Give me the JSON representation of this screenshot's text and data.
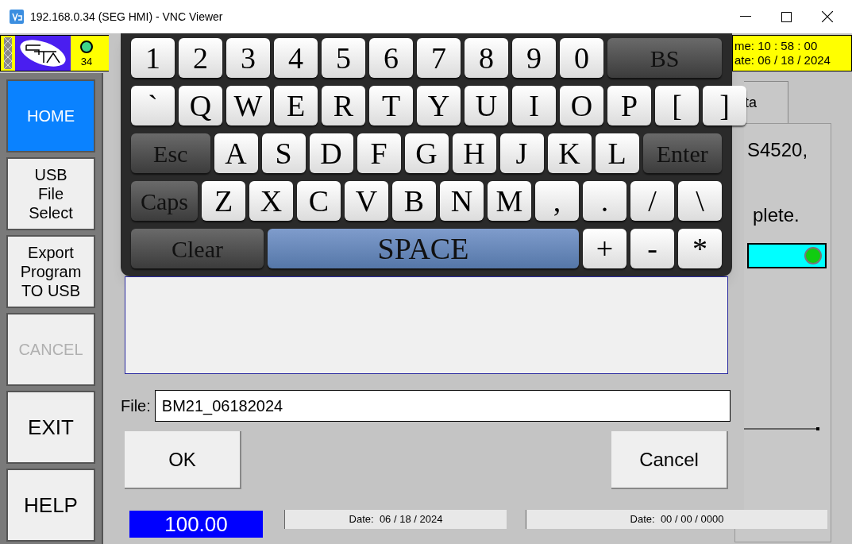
{
  "window": {
    "title": "192.168.0.34 (SEG HMI) - VNC Viewer"
  },
  "header": {
    "counter": "34",
    "status_on": true,
    "time": "me: 10 : 58 : 00",
    "date": "ate: 06 / 18 / 2024"
  },
  "sidebar": {
    "items": [
      {
        "label": "HOME",
        "selected": true,
        "disabled": false,
        "large": false
      },
      {
        "label": "USB\nFile\nSelect",
        "selected": false,
        "disabled": false,
        "large": false
      },
      {
        "label": "Export\nProgram\nTO USB",
        "selected": false,
        "disabled": false,
        "large": false
      },
      {
        "label": "CANCEL",
        "selected": false,
        "disabled": true,
        "large": false
      },
      {
        "label": "EXIT",
        "selected": false,
        "disabled": false,
        "large": true
      },
      {
        "label": "HELP",
        "selected": false,
        "disabled": false,
        "large": true
      }
    ]
  },
  "background_panel": {
    "tab": "ta",
    "line_1": "S4520,",
    "line_2": "plete.",
    "indicator_on": true
  },
  "bottom_panels": {
    "value": "100.00",
    "date_1": "Date:  06 / 18 / 2024",
    "date_2": "Date:  00 / 00 / 0000"
  },
  "keyboard": {
    "rows": [
      {
        "keys": [
          {
            "label": "1",
            "kind": "char"
          },
          {
            "label": "2",
            "kind": "char"
          },
          {
            "label": "3",
            "kind": "char"
          },
          {
            "label": "4",
            "kind": "char"
          },
          {
            "label": "5",
            "kind": "char"
          },
          {
            "label": "6",
            "kind": "char"
          },
          {
            "label": "7",
            "kind": "char"
          },
          {
            "label": "8",
            "kind": "char"
          },
          {
            "label": "9",
            "kind": "char"
          },
          {
            "label": "0",
            "kind": "char"
          },
          {
            "label": "BS",
            "kind": "function"
          }
        ]
      },
      {
        "keys": [
          {
            "label": "`",
            "kind": "char"
          },
          {
            "label": "Q",
            "kind": "char"
          },
          {
            "label": "W",
            "kind": "char"
          },
          {
            "label": "E",
            "kind": "char"
          },
          {
            "label": "R",
            "kind": "char"
          },
          {
            "label": "T",
            "kind": "char"
          },
          {
            "label": "Y",
            "kind": "char"
          },
          {
            "label": "U",
            "kind": "char"
          },
          {
            "label": "I",
            "kind": "char"
          },
          {
            "label": "O",
            "kind": "char"
          },
          {
            "label": "P",
            "kind": "char"
          },
          {
            "label": "[",
            "kind": "char"
          },
          {
            "label": "]",
            "kind": "char"
          }
        ]
      },
      {
        "keys": [
          {
            "label": "Esc",
            "kind": "function"
          },
          {
            "label": "A",
            "kind": "char"
          },
          {
            "label": "S",
            "kind": "char"
          },
          {
            "label": "D",
            "kind": "char"
          },
          {
            "label": "F",
            "kind": "char"
          },
          {
            "label": "G",
            "kind": "char"
          },
          {
            "label": "H",
            "kind": "char"
          },
          {
            "label": "J",
            "kind": "char"
          },
          {
            "label": "K",
            "kind": "char"
          },
          {
            "label": "L",
            "kind": "char"
          },
          {
            "label": "Enter",
            "kind": "function"
          }
        ]
      },
      {
        "keys": [
          {
            "label": "Caps",
            "kind": "function"
          },
          {
            "label": "Z",
            "kind": "char"
          },
          {
            "label": "X",
            "kind": "char"
          },
          {
            "label": "C",
            "kind": "char"
          },
          {
            "label": "V",
            "kind": "char"
          },
          {
            "label": "B",
            "kind": "char"
          },
          {
            "label": "N",
            "kind": "char"
          },
          {
            "label": "M",
            "kind": "char"
          },
          {
            "label": ",",
            "kind": "char"
          },
          {
            "label": ".",
            "kind": "char"
          },
          {
            "label": "/",
            "kind": "char"
          },
          {
            "label": "\\",
            "kind": "char"
          }
        ]
      },
      {
        "keys": [
          {
            "label": "Clear",
            "kind": "function"
          },
          {
            "label": "SPACE",
            "kind": "space"
          },
          {
            "label": "+",
            "kind": "char"
          },
          {
            "label": "-",
            "kind": "char"
          },
          {
            "label": "*",
            "kind": "char"
          }
        ]
      }
    ]
  },
  "dialog": {
    "file_label": "File:",
    "file_value": "BM21_06182024",
    "ok": "OK",
    "cancel": "Cancel"
  }
}
